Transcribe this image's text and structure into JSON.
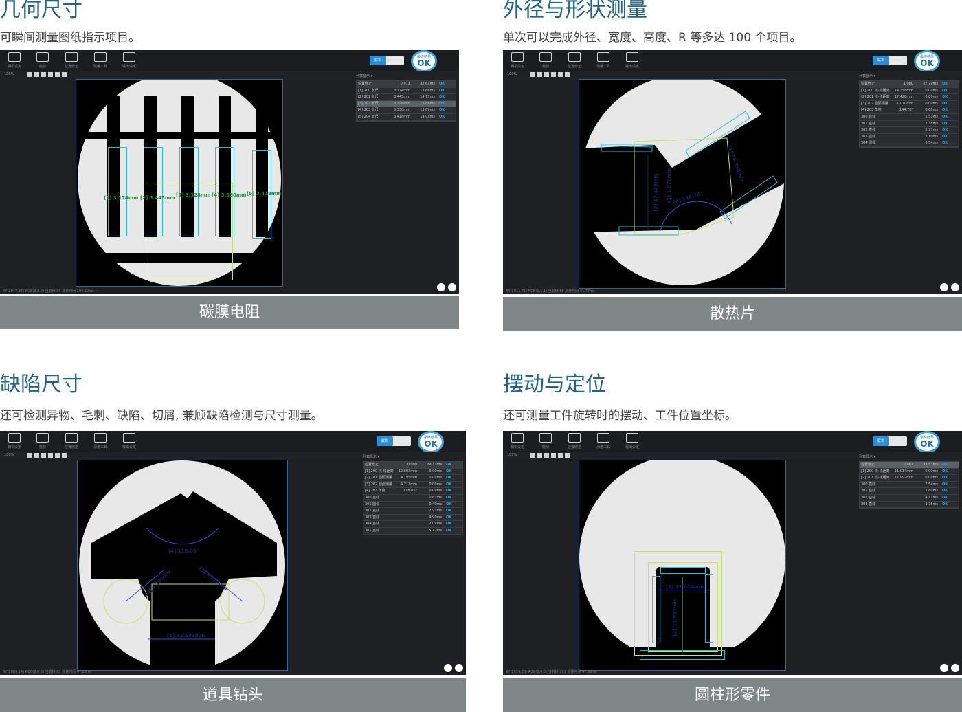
{
  "sections": [
    {
      "title": "几何尺寸",
      "subtitle": "可瞬间测量图纸指示项目。",
      "caption": "碳膜电阻",
      "zoom": "100%",
      "list_label": "列表显示",
      "rows": [
        [
          "位置修正",
          "0.971",
          "32.61ms"
        ],
        [
          "[1] 200 长尺",
          "3.174mm",
          "13.86ms"
        ],
        [
          "[2] 201 长尺",
          "3.445mm",
          "14.17ms"
        ],
        [
          "[3] 202 长尺",
          "3.328mm",
          "13.66ms"
        ],
        [
          "[4] 203 长尺",
          "3.330mm",
          "13.89ms"
        ],
        [
          "[5] 204 长尺",
          "3.418mm",
          "14.08ms"
        ]
      ],
      "status": "XY(2047,87)  RGB(0,0,0)        当前帧 33                    测量时间 104.12ms",
      "measures": [
        "[1] 3.174mm",
        "[2] 3.445mm",
        "[3] 3.328mm",
        "[4] 3.330mm",
        "[5] 3.418mm"
      ]
    },
    {
      "title": "外径与形状测量",
      "subtitle": "单次可以完成外径、宽度、高度、R 等多达 100 个项目。",
      "caption": "散热片",
      "zoom": "100%",
      "list_label": "列表显示",
      "rows": [
        [
          "位置修正",
          "1.000",
          "27.79ms"
        ],
        [
          "[1] 200 线-线距离",
          "14.358mm",
          "0.00ms"
        ],
        [
          "[2] 201 线-线距离",
          "17.428mm",
          "0.00ms"
        ],
        [
          "[3] 202 圆弧测量",
          "1.070mm",
          "0.00ms"
        ],
        [
          "[4] 203 角度",
          "144.78°",
          "0.00ms"
        ],
        [
          "300 直线",
          "",
          "5.51ms"
        ],
        [
          "301 直线",
          "",
          "2.38ms"
        ],
        [
          "302 直线",
          "",
          "2.77ms"
        ],
        [
          "303 直线",
          "",
          "3.10ms"
        ],
        [
          "304 圆弧",
          "",
          "0.54ms"
        ]
      ],
      "status": "XY(1911,71)  RGB(1,1,1)        当前帧 58                    测量时间 41.77ms",
      "measures": [
        "[1] 14.358mm",
        "[2] 17.428mm",
        "[3] 1.070mm",
        "[4] 144.78°"
      ]
    },
    {
      "title": "缺陷尺寸",
      "subtitle": "还可检测异物、毛刺、缺陷、切屑, 兼顾缺陷检测与尺寸测量。",
      "caption": "道具钻头",
      "zoom": "100%",
      "list_label": "列表显示",
      "rows": [
        [
          "位置修正",
          "0.999",
          "29.31ms"
        ],
        [
          "[1] 200 线-线距离",
          "12.693mm",
          "0.00ms"
        ],
        [
          "[2] 201 圆弧测量",
          "4.195mm",
          "0.00ms"
        ],
        [
          "[3] 202 圆弧测量",
          "4.211mm",
          "0.00ms"
        ],
        [
          "[4] 203 角度",
          "118.05°",
          "0.00ms"
        ],
        [
          "300 直线",
          "",
          "0.61ms"
        ],
        [
          "301 圆弧",
          "",
          "0.49ms"
        ],
        [
          "302 直线",
          "",
          "2.92ms"
        ],
        [
          "303 直线",
          "",
          "4.90ms"
        ],
        [
          "304 直线",
          "",
          "2.09ms"
        ],
        [
          "305 直线",
          "",
          "5.12ms"
        ]
      ],
      "status": "XY(2005,14)  RGB(0,0,0)        当前帧 82                    测量时间 47.25ms",
      "measures": [
        "[1] 12.693mm",
        "[2] 4.195mm",
        "[3] 4.211mm",
        "[4] 118.05°"
      ]
    },
    {
      "title": "摆动与定位",
      "subtitle": "还可测量工件旋转时的摆动、工件位置坐标。",
      "caption": "圆柱形零件",
      "zoom": "100%",
      "list_label": "列表显示",
      "rows": [
        [
          "位置修正",
          "0.987",
          "33.53ms"
        ],
        [
          "[1] 200 线-线距离",
          "11.014mm",
          "0.00ms"
        ],
        [
          "[2] 201 线-线距离",
          "17.997mm",
          "0.00ms"
        ],
        [
          "300 直线",
          "",
          "2.54ms"
        ],
        [
          "301 直线",
          "",
          "2.80ms"
        ],
        [
          "302 直线",
          "",
          "4.11ms"
        ],
        [
          "303 直线",
          "",
          "3.75ms"
        ]
      ],
      "status": "XY(2019,23)  RGB(0,0,0)        当前帧 261                   测量时间 47.98ms",
      "measures": [
        "[1] 11.014mm",
        "[2] 17.997mm"
      ]
    }
  ],
  "toolbar": [
    "相机设定",
    "检测",
    "位置修正",
    "测量工具",
    "输出设定"
  ],
  "toggle_label": "联机",
  "ok_badge": {
    "caption": "最终结果",
    "value": "OK"
  },
  "colors": {
    "title": "#20638b",
    "caption_bar": "#7f8688",
    "ok": "#27a9e6"
  }
}
